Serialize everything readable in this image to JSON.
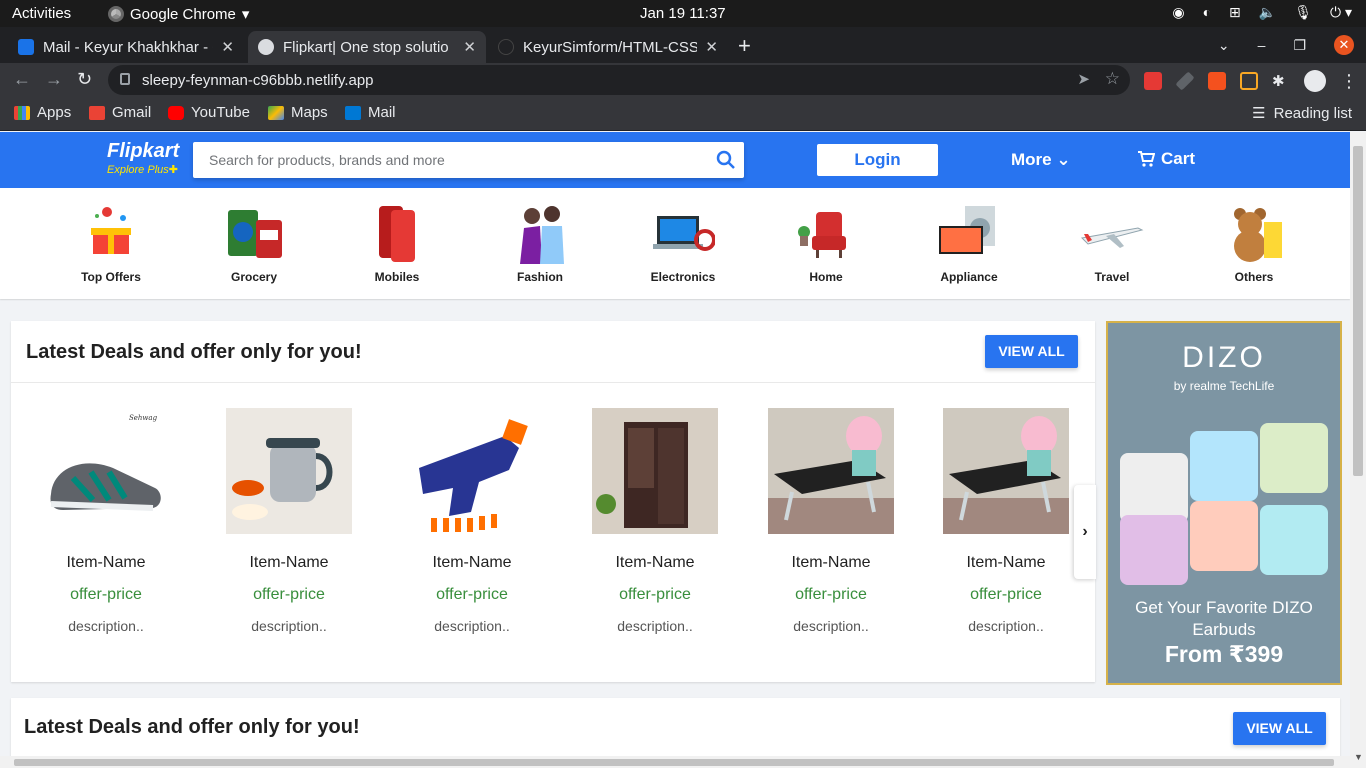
{
  "system_bar": {
    "activities": "Activities",
    "app_name": "Google Chrome",
    "clock": "Jan 19  11:37"
  },
  "tabs": [
    {
      "title": "Mail - Keyur Khakhkhar - O"
    },
    {
      "title": "Flipkart| One stop solutio"
    },
    {
      "title": "KeyurSimform/HTML-CSS"
    }
  ],
  "address_bar": {
    "url": "sleepy-feynman-c96bbb.netlify.app"
  },
  "bookmarks": {
    "items": [
      {
        "label": "Apps"
      },
      {
        "label": "Gmail"
      },
      {
        "label": "YouTube"
      },
      {
        "label": "Maps"
      },
      {
        "label": "Mail"
      }
    ],
    "reading_list": "Reading list"
  },
  "header": {
    "logo": "Flipkart",
    "logo_tagline": "Explore",
    "logo_plus": "Plus",
    "search_placeholder": "Search for products, brands and more",
    "login": "Login",
    "more": "More",
    "cart": "Cart",
    "accent_color": "#2874f0"
  },
  "categories": [
    {
      "label": "Top Offers"
    },
    {
      "label": "Grocery"
    },
    {
      "label": "Mobiles"
    },
    {
      "label": "Fashion"
    },
    {
      "label": "Electronics"
    },
    {
      "label": "Home"
    },
    {
      "label": "Appliance"
    },
    {
      "label": "Travel"
    },
    {
      "label": "Others"
    }
  ],
  "deals": {
    "title": "Latest Deals and offer only for you!",
    "view_all": "VIEW ALL",
    "items": [
      {
        "name": "Item-Name",
        "price": "offer-price",
        "description": "description.."
      },
      {
        "name": "Item-Name",
        "price": "offer-price",
        "description": "description.."
      },
      {
        "name": "Item-Name",
        "price": "offer-price",
        "description": "description.."
      },
      {
        "name": "Item-Name",
        "price": "offer-price",
        "description": "description.."
      },
      {
        "name": "Item-Name",
        "price": "offer-price",
        "description": "description.."
      },
      {
        "name": "Item-Name",
        "price": "offer-price",
        "description": "description.."
      }
    ]
  },
  "ad": {
    "brand": "DIZO",
    "by": "by realme TechLife",
    "tagline": "Get Your Favorite DIZO Earbuds",
    "price": "From ₹399"
  },
  "deals2": {
    "title": "Latest Deals and offer only for you!",
    "view_all": "VIEW ALL"
  }
}
